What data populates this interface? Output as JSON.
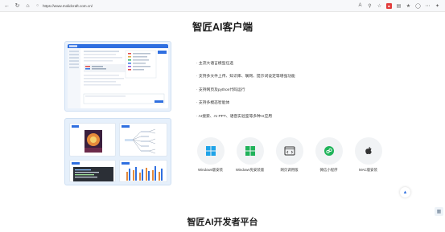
{
  "browser": {
    "url": "https://www.molidcraft.com.cn/"
  },
  "page": {
    "title": "智匠AI客户端",
    "section2_title": "智匠AI开发者平台"
  },
  "features": [
    "· 主流大语言模型任选",
    "· 支持多文件上传、知识库、联网、提示词设定等增强功能",
    "· 支持网页及python代码运行",
    "· 支持多模态智能体",
    "· AI搜索、AI PPT、语音实验室等多种AI应用"
  ],
  "downloads": [
    {
      "label": "Windows版安装",
      "icon": "windows-icon",
      "color": "#1fa3e8"
    },
    {
      "label": "Windows免安装版",
      "icon": "windows-icon",
      "color": "#21b35b"
    },
    {
      "label": "网页调用版",
      "icon": "browser-window-icon",
      "color": "#333333"
    },
    {
      "label": "微信小程序",
      "icon": "mini-program-icon",
      "color": "#20b45a"
    },
    {
      "label": "MAC版安装",
      "icon": "apple-icon",
      "color": "#333333"
    }
  ],
  "colors": {
    "accent": "#2f6fe0",
    "mock_bg": "#e9f1fb"
  }
}
